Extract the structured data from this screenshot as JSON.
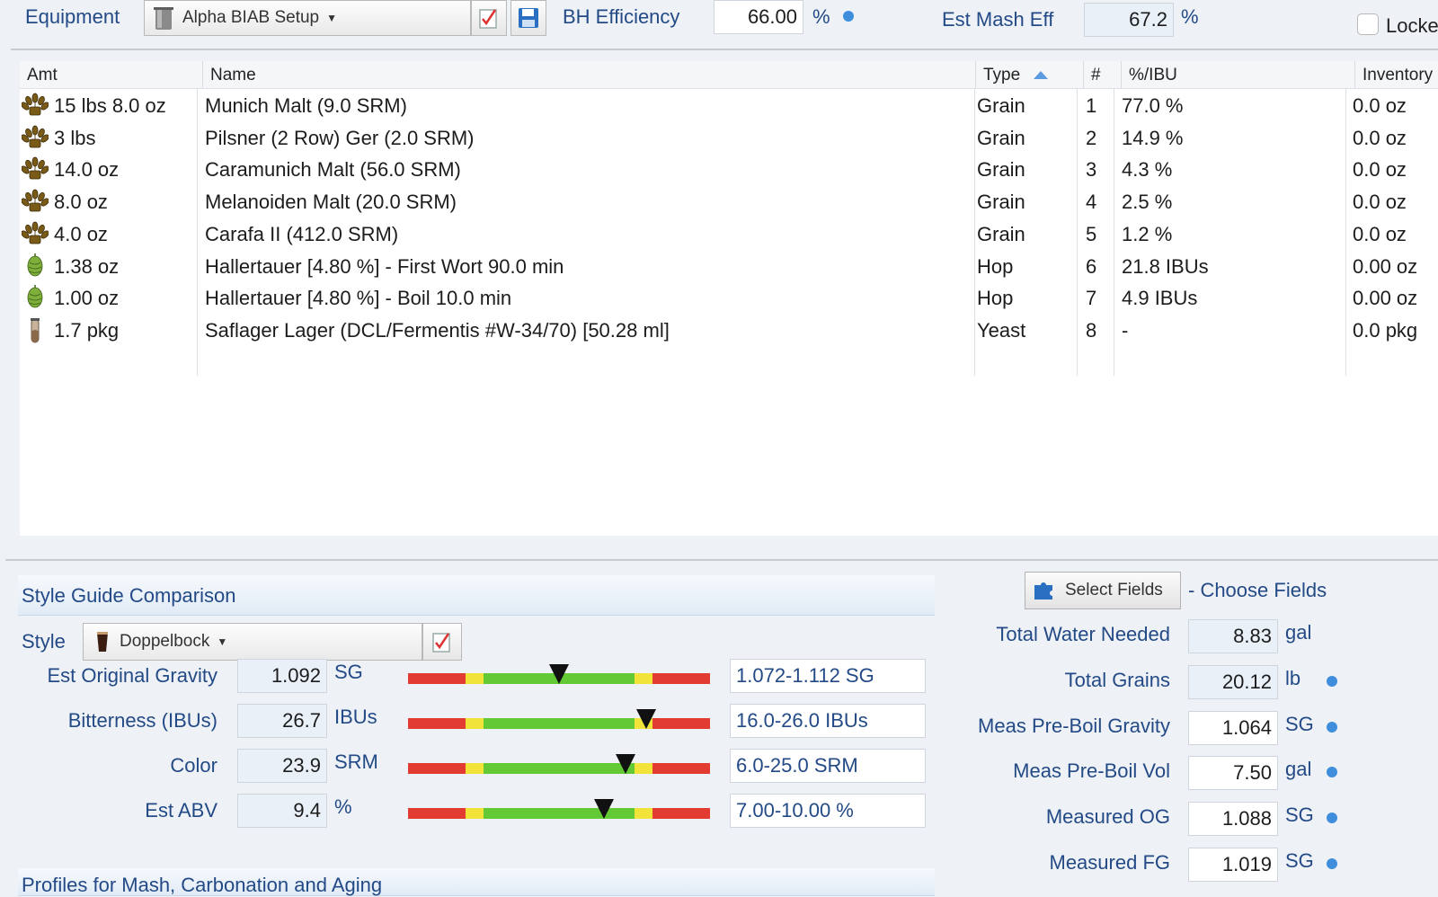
{
  "toolbar": {
    "equipment_label": "Equipment",
    "equipment_value": "Alpha BIAB Setup",
    "bh_eff_label": "BH Efficiency",
    "bh_eff_value": "66.00",
    "bh_eff_unit": "%",
    "mash_eff_label": "Est Mash Eff",
    "mash_eff_value": "67.2",
    "mash_eff_unit": "%",
    "locked_label": "Locke"
  },
  "table": {
    "headers": [
      "Amt",
      "Name",
      "Type",
      "#",
      "%/IBU",
      "Inventory"
    ],
    "sort_icon": "sort-up-icon",
    "rows": [
      {
        "icon": "grain-icon",
        "amt": "15 lbs 8.0 oz",
        "name": "Munich Malt (9.0 SRM)",
        "type": "Grain",
        "num": "1",
        "pct": "77.0 %",
        "inv": "0.0 oz"
      },
      {
        "icon": "grain-icon",
        "amt": "3 lbs",
        "name": "Pilsner (2 Row) Ger (2.0 SRM)",
        "type": "Grain",
        "num": "2",
        "pct": "14.9 %",
        "inv": "0.0 oz"
      },
      {
        "icon": "grain-icon",
        "amt": "14.0 oz",
        "name": "Caramunich Malt (56.0 SRM)",
        "type": "Grain",
        "num": "3",
        "pct": "4.3 %",
        "inv": "0.0 oz"
      },
      {
        "icon": "grain-icon",
        "amt": "8.0 oz",
        "name": "Melanoiden Malt (20.0 SRM)",
        "type": "Grain",
        "num": "4",
        "pct": "2.5 %",
        "inv": "0.0 oz"
      },
      {
        "icon": "grain-icon",
        "amt": "4.0 oz",
        "name": "Carafa II (412.0 SRM)",
        "type": "Grain",
        "num": "5",
        "pct": "1.2 %",
        "inv": "0.0 oz"
      },
      {
        "icon": "hop-icon",
        "amt": "1.38 oz",
        "name": "Hallertauer [4.80 %] - First Wort 90.0 min",
        "type": "Hop",
        "num": "6",
        "pct": "21.8 IBUs",
        "inv": "0.00 oz"
      },
      {
        "icon": "hop-icon",
        "amt": "1.00 oz",
        "name": "Hallertauer [4.80 %] - Boil 10.0 min",
        "type": "Hop",
        "num": "7",
        "pct": "4.9 IBUs",
        "inv": "0.00 oz"
      },
      {
        "icon": "yeast-vial-icon",
        "amt": "1.7 pkg",
        "name": "Saflager Lager (DCL/Fermentis #W-34/70) [50.28 ml]",
        "type": "Yeast",
        "num": "8",
        "pct": "-",
        "inv": "0.0 pkg"
      }
    ]
  },
  "style_guide": {
    "title": "Style Guide Comparison",
    "style_label": "Style",
    "style_value": "Doppelbock",
    "rows": [
      {
        "label": "Est Original Gravity",
        "value": "1.092",
        "unit": "SG",
        "range": "1.072-1.112 SG",
        "position": 0.5
      },
      {
        "label": "Bitterness (IBUs)",
        "value": "26.7",
        "unit": "IBUs",
        "range": "16.0-26.0 IBUs",
        "position": 0.79
      },
      {
        "label": "Color",
        "value": "23.9",
        "unit": "SRM",
        "range": "6.0-25.0 SRM",
        "position": 0.72
      },
      {
        "label": "Est ABV",
        "value": "9.4",
        "unit": "%",
        "range": "7.00-10.00 %",
        "position": 0.65
      }
    ],
    "profiles_title": "Profiles for Mash, Carbonation and Aging"
  },
  "fields_panel": {
    "select_button": "Select Fields",
    "choose_label": "- Choose Fields",
    "rows": [
      {
        "label": "Total Water Needed",
        "value": "8.83",
        "unit": "gal",
        "dot": false
      },
      {
        "label": "Total Grains",
        "value": "20.12",
        "unit": "lb",
        "dot": true
      },
      {
        "label": "Meas Pre-Boil Gravity",
        "value": "1.064",
        "unit": "SG",
        "dot": true
      },
      {
        "label": "Meas Pre-Boil Vol",
        "value": "7.50",
        "unit": "gal",
        "dot": true
      },
      {
        "label": "Measured OG",
        "value": "1.088",
        "unit": "SG",
        "dot": true
      },
      {
        "label": "Measured FG",
        "value": "1.019",
        "unit": "SG",
        "dot": true
      }
    ]
  },
  "colors": {
    "label_blue": "#234a86",
    "dot_blue": "#3f8ede",
    "bar_red": "#e23b32",
    "bar_yellow": "#f1e33a",
    "bar_green": "#63c934"
  }
}
